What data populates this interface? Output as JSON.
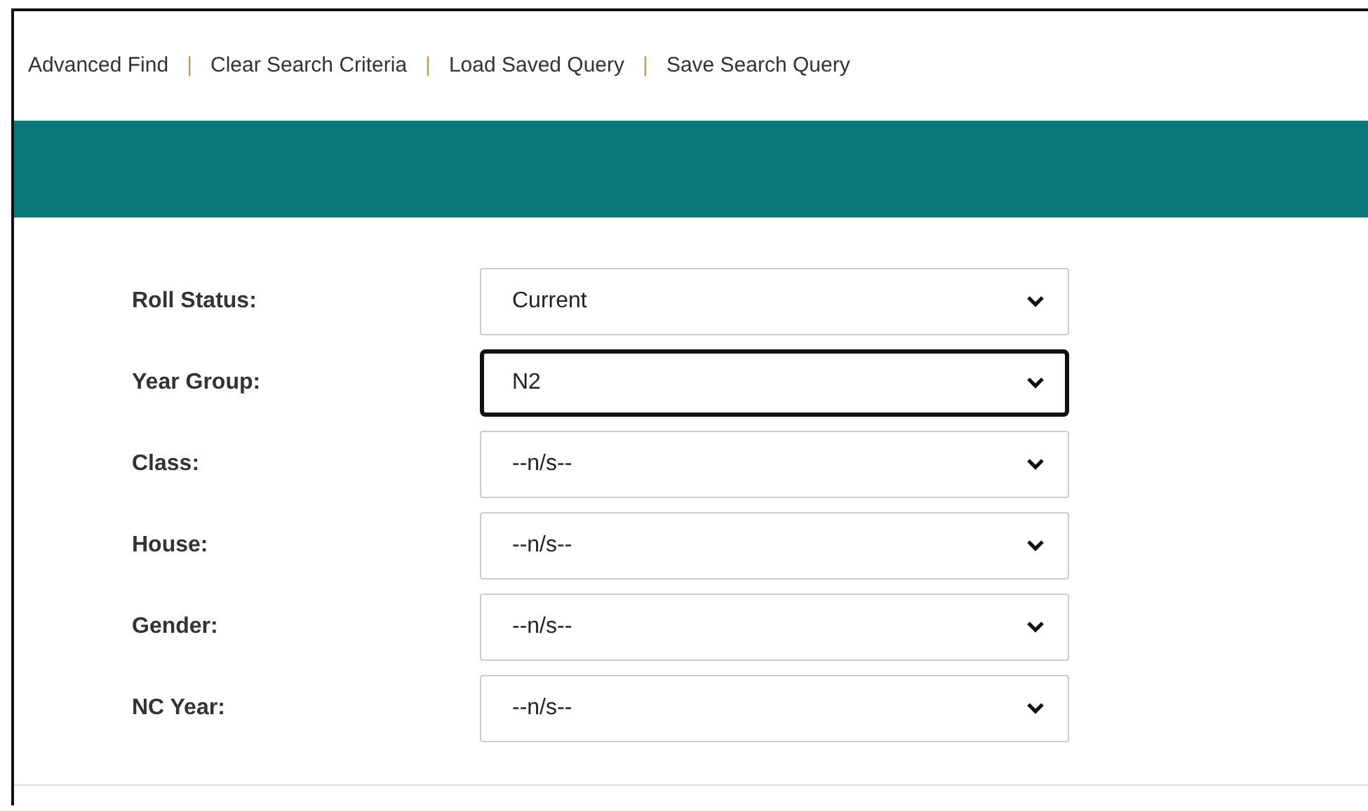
{
  "links": [
    {
      "label": "Advanced Find"
    },
    {
      "label": "Clear Search Criteria"
    },
    {
      "label": "Load Saved Query"
    },
    {
      "label": "Save Search Query"
    }
  ],
  "separator": "|",
  "fields": [
    {
      "label": "Roll Status:",
      "value": "Current",
      "focused": false
    },
    {
      "label": "Year Group:",
      "value": "N2",
      "focused": true
    },
    {
      "label": "Class:",
      "value": "--n/s--",
      "focused": false
    },
    {
      "label": "House:",
      "value": "--n/s--",
      "focused": false
    },
    {
      "label": "Gender:",
      "value": "--n/s--",
      "focused": false
    },
    {
      "label": "NC Year:",
      "value": "--n/s--",
      "focused": false
    }
  ]
}
